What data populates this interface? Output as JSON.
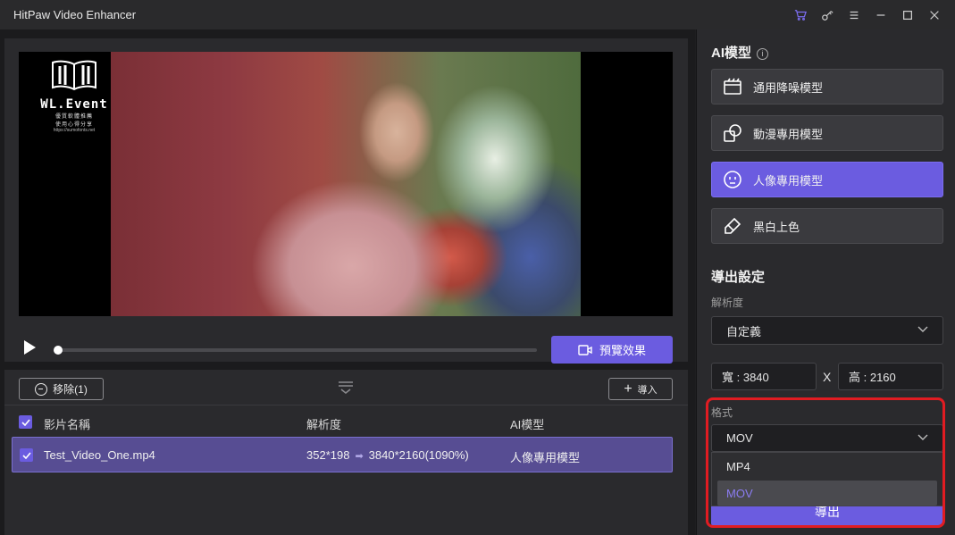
{
  "app": {
    "title": "HitPaw Video Enhancer",
    "titlebar_icons": [
      "cart-icon",
      "key-icon",
      "menu-icon",
      "minimize-icon",
      "maximize-icon",
      "close-icon"
    ]
  },
  "watermark": {
    "name": "WL.Event",
    "subtitle": "優質軟體推薦",
    "subtitle2": "使用心得分享",
    "url": "https://sumofonts.net"
  },
  "player": {
    "preview_label": "預覽效果",
    "progress": 0
  },
  "file_list": {
    "remove_label": "移除(1)",
    "import_label": "導入",
    "headers": {
      "name": "影片名稱",
      "resolution": "解析度",
      "model": "AI模型"
    },
    "rows": [
      {
        "name": "Test_Video_One.mp4",
        "from": "352*198",
        "to": "3840*2160(1090%)",
        "model": "人像專用模型"
      }
    ]
  },
  "ai_models": {
    "title": "AI模型",
    "items": [
      {
        "label": "通用降噪模型",
        "icon": "film-icon",
        "active": false
      },
      {
        "label": "動漫專用模型",
        "icon": "shapes-icon",
        "active": false
      },
      {
        "label": "人像專用模型",
        "icon": "face-icon",
        "active": true
      },
      {
        "label": "黑白上色",
        "icon": "brush-icon",
        "active": false
      }
    ]
  },
  "export_settings": {
    "title": "導出設定",
    "resolution_label": "解析度",
    "resolution_value": "自定義",
    "width_text": "寬 : 3840",
    "separator": "X",
    "height_text": "高 : 2160",
    "format_label": "格式",
    "format_value": "MOV",
    "format_options": [
      "MP4",
      "MOV"
    ],
    "export_label": "導出"
  },
  "colors": {
    "accent": "#6b5ce0",
    "highlight": "#e11c22"
  }
}
